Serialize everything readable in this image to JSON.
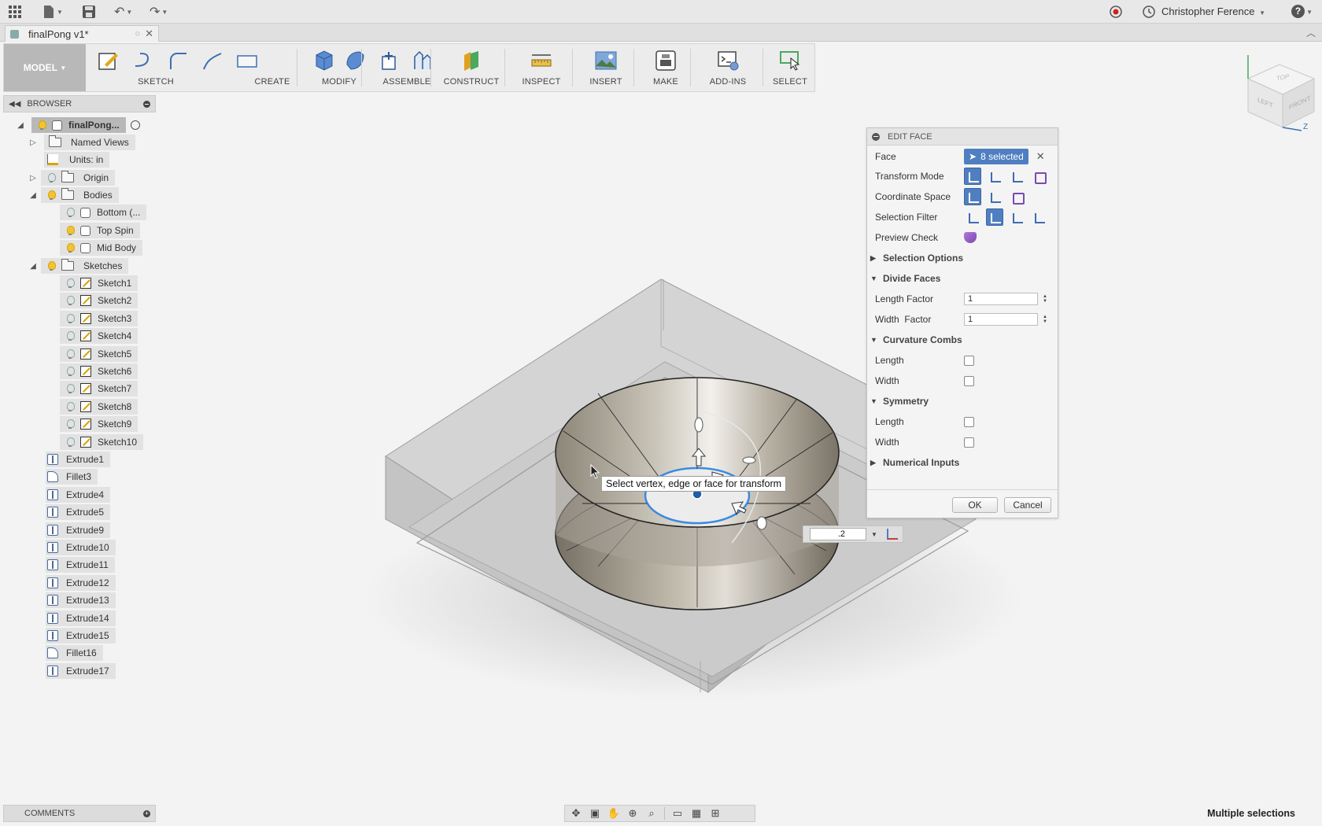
{
  "topbar": {
    "user": "Christopher Ference",
    "help": "?"
  },
  "document": {
    "tab_title": "finalPong v1*"
  },
  "ribbon": {
    "mode": "MODEL",
    "groups": [
      "SKETCH",
      "CREATE",
      "MODIFY",
      "ASSEMBLE",
      "CONSTRUCT",
      "INSPECT",
      "INSERT",
      "MAKE",
      "ADD-INS",
      "SELECT"
    ]
  },
  "browser": {
    "title": "BROWSER",
    "root": "finalPong...",
    "named_views": "Named Views",
    "units": "Units: in",
    "origin": "Origin",
    "bodies": "Bodies",
    "body_items": [
      "Bottom (...",
      "Top Spin",
      "Mid Body"
    ],
    "sketches": "Sketches",
    "sketch_items": [
      "Sketch1",
      "Sketch2",
      "Sketch3",
      "Sketch4",
      "Sketch5",
      "Sketch6",
      "Sketch7",
      "Sketch8",
      "Sketch9",
      "Sketch10"
    ],
    "features": [
      "Extrude1",
      "Fillet3",
      "Extrude4",
      "Extrude5",
      "Extrude9",
      "Extrude10",
      "Extrude11",
      "Extrude12",
      "Extrude13",
      "Extrude14",
      "Extrude15",
      "Fillet16",
      "Extrude17"
    ]
  },
  "comments": {
    "title": "COMMENTS"
  },
  "edit_face": {
    "title": "EDIT FACE",
    "face_label": "Face",
    "face_value": "8 selected",
    "transform_mode": "Transform Mode",
    "coordinate_space": "Coordinate Space",
    "selection_filter": "Selection Filter",
    "preview_check": "Preview Check",
    "selection_options": "Selection Options",
    "divide_faces": "Divide Faces",
    "length_factor": "Length Factor",
    "length_factor_value": "1",
    "width_factor": "Width  Factor",
    "width_factor_value": "1",
    "curvature_combs": "Curvature Combs",
    "length": "Length",
    "width": "Width",
    "symmetry": "Symmetry",
    "numerical_inputs": "Numerical Inputs",
    "ok": "OK",
    "cancel": "Cancel"
  },
  "viewport": {
    "tooltip": "Select vertex, edge or face for transform",
    "value_input": ".2",
    "viewcube_faces": [
      "TOP",
      "LEFT",
      "FRONT"
    ],
    "axis_z": "Z"
  },
  "status": {
    "text": "Multiple selections"
  }
}
